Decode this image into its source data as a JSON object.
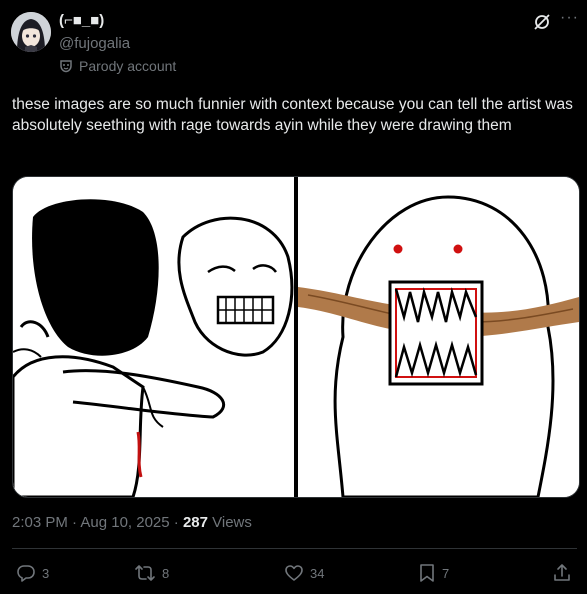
{
  "user": {
    "display_name": "(⌐■_■)",
    "handle": "@fujogalia",
    "badge_label": "Parody account"
  },
  "tweet": {
    "text": "these images are so much funnier with context because you can tell the artist was absolutely seething with rage towards ayin while they were drawing them"
  },
  "meta": {
    "time": "2:03 PM · Aug 10, 2025 · ",
    "views_count": "287",
    "views_label": " Views"
  },
  "actions": {
    "replies": "3",
    "reposts": "8",
    "likes": "34",
    "bookmarks": "7"
  },
  "icons": [
    "grok-icon",
    "more-icon",
    "parody-mask-icon",
    "reply-icon",
    "repost-icon",
    "like-icon",
    "bookmark-icon",
    "share-icon"
  ],
  "colors": {
    "background": "#000000",
    "text": "#e7e9ea",
    "muted": "#71767b",
    "border": "#2f3336"
  }
}
